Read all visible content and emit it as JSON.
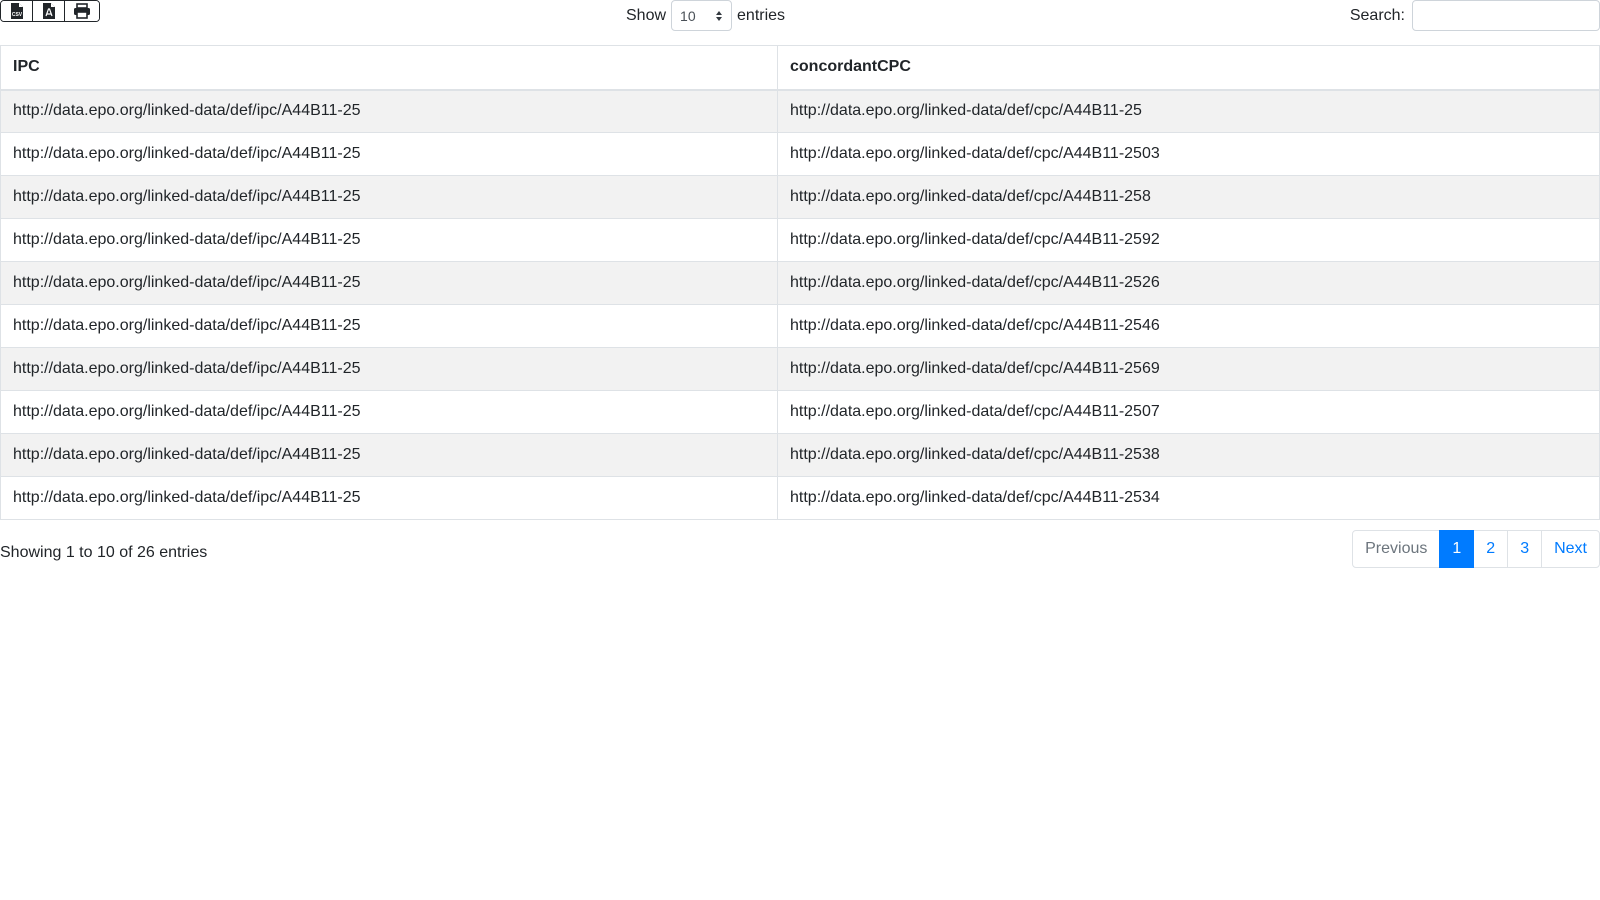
{
  "toolbar": {
    "buttons": [
      {
        "name": "csv-export",
        "icon": "file-csv-icon"
      },
      {
        "name": "pdf-export",
        "icon": "file-pdf-icon"
      },
      {
        "name": "print",
        "icon": "printer-icon"
      }
    ]
  },
  "length": {
    "show_label": "Show",
    "selected": "10",
    "entries_label": "entries"
  },
  "search": {
    "label": "Search:",
    "value": ""
  },
  "table": {
    "headers": [
      "IPC",
      "concordantCPC"
    ],
    "rows": [
      [
        "http://data.epo.org/linked-data/def/ipc/A44B11-25",
        "http://data.epo.org/linked-data/def/cpc/A44B11-25"
      ],
      [
        "http://data.epo.org/linked-data/def/ipc/A44B11-25",
        "http://data.epo.org/linked-data/def/cpc/A44B11-2503"
      ],
      [
        "http://data.epo.org/linked-data/def/ipc/A44B11-25",
        "http://data.epo.org/linked-data/def/cpc/A44B11-258"
      ],
      [
        "http://data.epo.org/linked-data/def/ipc/A44B11-25",
        "http://data.epo.org/linked-data/def/cpc/A44B11-2592"
      ],
      [
        "http://data.epo.org/linked-data/def/ipc/A44B11-25",
        "http://data.epo.org/linked-data/def/cpc/A44B11-2526"
      ],
      [
        "http://data.epo.org/linked-data/def/ipc/A44B11-25",
        "http://data.epo.org/linked-data/def/cpc/A44B11-2546"
      ],
      [
        "http://data.epo.org/linked-data/def/ipc/A44B11-25",
        "http://data.epo.org/linked-data/def/cpc/A44B11-2569"
      ],
      [
        "http://data.epo.org/linked-data/def/ipc/A44B11-25",
        "http://data.epo.org/linked-data/def/cpc/A44B11-2507"
      ],
      [
        "http://data.epo.org/linked-data/def/ipc/A44B11-25",
        "http://data.epo.org/linked-data/def/cpc/A44B11-2538"
      ],
      [
        "http://data.epo.org/linked-data/def/ipc/A44B11-25",
        "http://data.epo.org/linked-data/def/cpc/A44B11-2534"
      ]
    ]
  },
  "info": "Showing 1 to 10 of 26 entries",
  "pagination": {
    "previous": "Previous",
    "pages": [
      "1",
      "2",
      "3"
    ],
    "active": "1",
    "next": "Next"
  },
  "colors": {
    "accent": "#007bff",
    "stripe": "#f2f2f2",
    "border": "#dee2e6"
  }
}
